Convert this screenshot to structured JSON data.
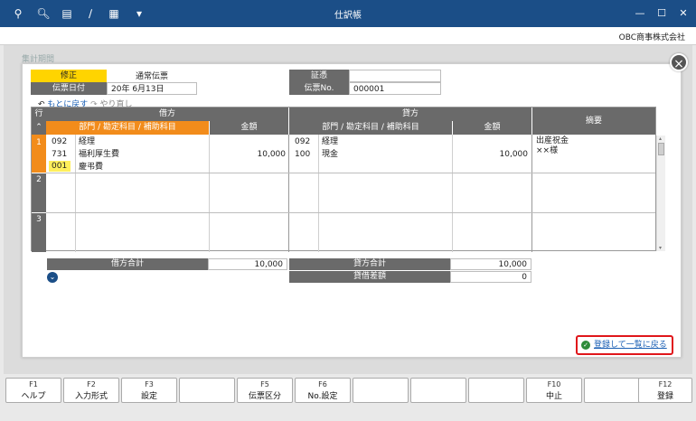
{
  "window": {
    "title": "仕訳帳"
  },
  "toolbar": {
    "icons": [
      "search-plus-icon",
      "zoom-icon",
      "print-icon",
      "formula-icon",
      "excel-icon",
      "dropdown-icon"
    ]
  },
  "company": "OBC商事株式会社",
  "background_strip": "集計期間",
  "form": {
    "mode_label": "修正",
    "slip_type": "通常伝票",
    "date_label": "伝票日付",
    "date_value": "20年 6月13日",
    "evidence_label": "証憑",
    "evidence_value": "",
    "slip_no_label": "伝票No.",
    "slip_no_value": "000001",
    "undo_label": "もとに戻す",
    "redo_label": "やり直し"
  },
  "grid": {
    "row_header": "行",
    "debit_header": "借方",
    "credit_header": "貸方",
    "memo_header": "摘要",
    "dept_col": "部門 / 勘定科目 / 補助科目",
    "amount_col": "金額",
    "rows": [
      {
        "no": "1",
        "debit_codes": [
          "092",
          "731",
          "001"
        ],
        "debit_names": [
          "経理",
          "福利厚生費",
          "慶弔費"
        ],
        "debit_amount": "10,000",
        "credit_codes": [
          "092",
          "100"
        ],
        "credit_names": [
          "経理",
          "現金"
        ],
        "credit_amount": "10,000",
        "memo": [
          "出産祝金",
          "××様"
        ]
      },
      {
        "no": "2"
      },
      {
        "no": "3"
      }
    ]
  },
  "totals": {
    "debit_total_label": "借方合計",
    "debit_total_value": "10,000",
    "credit_total_label": "貸方合計",
    "credit_total_value": "10,000",
    "diff_label": "貸借差額",
    "diff_value": "0"
  },
  "save_link": "登録して一覧に戻る",
  "fkeys": [
    {
      "key": "F1",
      "label": "ヘルプ"
    },
    {
      "key": "F2",
      "label": "入力形式"
    },
    {
      "key": "F3",
      "label": "設定"
    },
    {
      "key": "",
      "label": ""
    },
    {
      "key": "F5",
      "label": "伝票区分"
    },
    {
      "key": "F6",
      "label": "No.設定"
    },
    {
      "key": "",
      "label": ""
    },
    {
      "key": "",
      "label": ""
    },
    {
      "key": "",
      "label": ""
    },
    {
      "key": "F10",
      "label": "中止"
    },
    {
      "key": "",
      "label": ""
    },
    {
      "key": "F12",
      "label": "登録"
    }
  ]
}
